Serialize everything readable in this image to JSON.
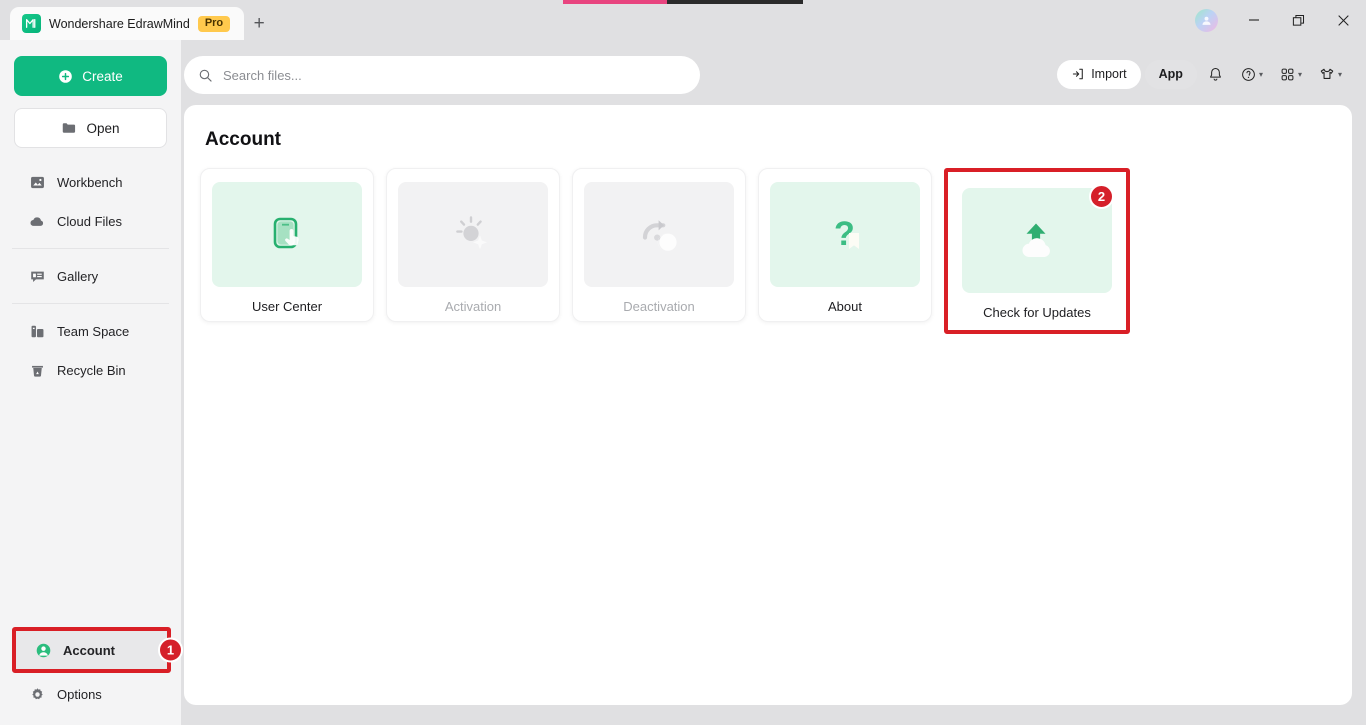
{
  "window": {
    "tab_title": "Wondershare EdrawMind",
    "pro_badge": "Pro",
    "logo_glyph": "M",
    "new_tab_glyph": "+",
    "minimize_icon": "minimize-icon",
    "restore_icon": "restore-icon",
    "close_icon": "close-icon",
    "avatar_icon": "user-avatar"
  },
  "accent": {
    "pink": "#e8447f",
    "dark": "#2b2b2b"
  },
  "search": {
    "placeholder": "Search files...",
    "value": "",
    "icon": "search-icon"
  },
  "toolbar": {
    "import_label": "Import",
    "app_label": "App",
    "notification_icon": "bell-icon",
    "help_icon": "question-circle-icon",
    "apps_icon": "grid-apps-icon",
    "theme_icon": "shirt-icon",
    "caret": "▾"
  },
  "sidebar": {
    "create_label": "Create",
    "open_label": "Open",
    "items": [
      {
        "label": "Workbench",
        "icon": "workbench-icon"
      },
      {
        "label": "Cloud Files",
        "icon": "cloud-icon"
      },
      {
        "label": "Gallery",
        "icon": "gallery-icon"
      },
      {
        "label": "Team Space",
        "icon": "team-space-icon"
      },
      {
        "label": "Recycle Bin",
        "icon": "recycle-bin-icon"
      }
    ],
    "account_label": "Account",
    "account_badge": "1",
    "options_label": "Options"
  },
  "main": {
    "title": "Account",
    "cards": [
      {
        "label": "User Center",
        "icon": "user-center-icon",
        "state": "enabled"
      },
      {
        "label": "Activation",
        "icon": "activation-icon",
        "state": "disabled"
      },
      {
        "label": "Deactivation",
        "icon": "deactivation-icon",
        "state": "disabled"
      },
      {
        "label": "About",
        "icon": "about-icon",
        "state": "enabled"
      },
      {
        "label": "Check for Updates",
        "icon": "update-cloud-icon",
        "state": "enabled",
        "badge": "2"
      }
    ]
  },
  "colors": {
    "brand_green": "#10b981",
    "annotation_red": "#d91f26",
    "badge_red": "#d5202a",
    "pro_yellow": "#ffc94d"
  }
}
